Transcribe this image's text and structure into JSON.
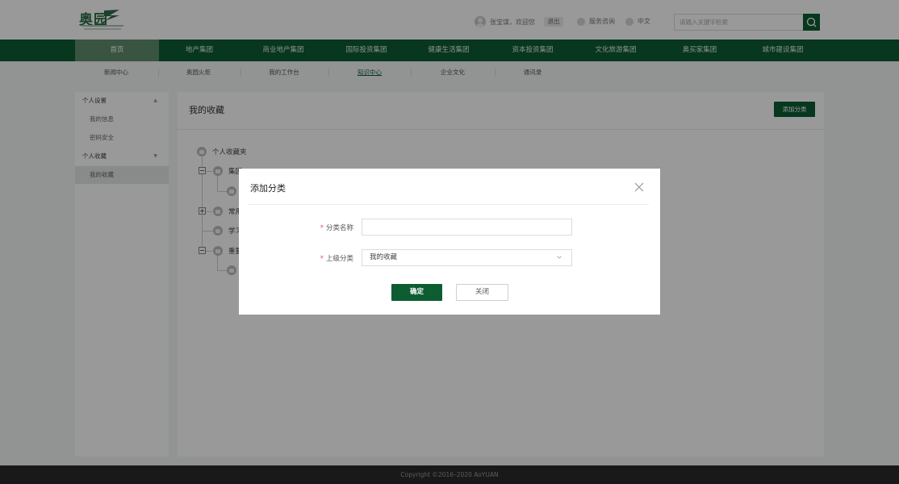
{
  "header": {
    "logo_text": "奥园",
    "greeting": "张宝谋，欢迎您",
    "logout": "退出",
    "service": "服务咨询",
    "language": "中文",
    "search_placeholder": "请输入关键字检索"
  },
  "nav": {
    "items": [
      "首页",
      "地产集团",
      "商业地产集团",
      "国际投资集团",
      "健康生活集团",
      "资本投资集团",
      "文化旅游集团",
      "奥买家集团",
      "城市建设集团"
    ],
    "active_index": 0
  },
  "subnav": {
    "items": [
      "新闻中心",
      "奥园火炬",
      "我的工作台",
      "知识中心",
      "企业文化",
      "通讯录"
    ],
    "active_index": 3
  },
  "sidebar": {
    "groups": [
      {
        "label": "个人设置",
        "items": [
          "我的信息",
          "密码安全"
        ]
      },
      {
        "label": "个人收藏",
        "items": [
          "我的收藏"
        ]
      }
    ],
    "active_item": "我的收藏"
  },
  "main": {
    "title": "我的收藏",
    "add_button": "添加分类",
    "tree": {
      "root": "个人收藏夹",
      "nodes": [
        "集团",
        "常用",
        "学习",
        "重要"
      ]
    }
  },
  "dialog": {
    "title": "添加分类",
    "fields": {
      "name_label": "分类名称",
      "name_value": "",
      "parent_label": "上级分类",
      "parent_value": "我的收藏"
    },
    "ok_label": "确定",
    "close_label": "关闭"
  },
  "footer": {
    "copyright": "Copyright ©2016–2020 AoYUAN"
  },
  "colors": {
    "brand_green": "#0d5d33",
    "nav_active": "#5f8c6d",
    "required": "#e05b5b"
  }
}
